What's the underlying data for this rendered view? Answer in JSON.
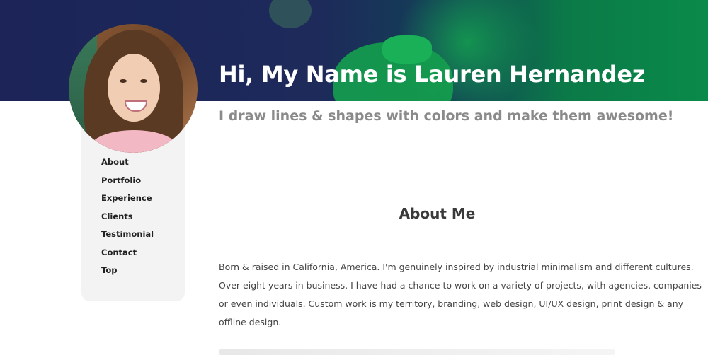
{
  "hero": {
    "title": "Hi, My Name is Lauren Hernandez",
    "tagline": "I draw lines & shapes with colors and make them awesome!"
  },
  "nav": {
    "items": [
      "About",
      "Portfolio",
      "Experience",
      "Clients",
      "Testimonial",
      "Contact",
      "Top"
    ]
  },
  "about": {
    "heading": "About Me",
    "lines": [
      "Born & raised in California, America. I'm genuinely inspired by industrial minimalism and different cultures.",
      "Over eight years in business, I have had a chance to work on a variety of projects, with agencies, companies",
      "or even individuals. Custom work is my territory, branding, web design, UI/UX design, print design & any",
      "offline design."
    ]
  },
  "colors": {
    "hero_navy": "#1c2458",
    "hero_green": "#0a8a4a",
    "sidebar_bg": "#f3f3f3",
    "text_dark": "#222222",
    "tagline_gray": "#8a8a8a"
  }
}
